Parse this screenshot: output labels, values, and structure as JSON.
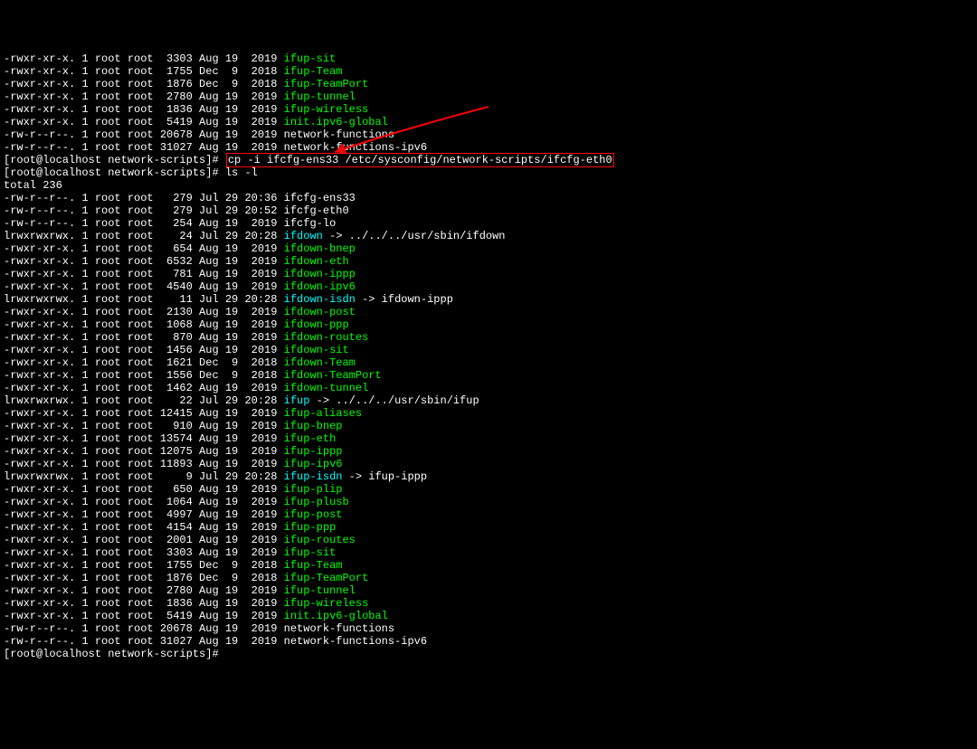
{
  "chart_data": null,
  "prompts": {
    "p1": "[root@localhost network-scripts]# ",
    "p2": "[root@localhost network-scripts]# ",
    "p3": "[root@localhost network-scripts]# "
  },
  "commands": {
    "cp": "cp -i ifcfg-ens33 /etc/sysconfig/network-scripts/ifcfg-eth0",
    "ls": "ls -l"
  },
  "headers": {
    "top_partial": [
      {
        "meta": "-rwxr-xr-x. 1 root root  3303 Aug 19  2019 ",
        "name": "ifup-sit",
        "cls": "g"
      },
      {
        "meta": "-rwxr-xr-x. 1 root root  1755 Dec  9  2018 ",
        "name": "ifup-Team",
        "cls": "g"
      },
      {
        "meta": "-rwxr-xr-x. 1 root root  1876 Dec  9  2018 ",
        "name": "ifup-TeamPort",
        "cls": "g"
      },
      {
        "meta": "-rwxr-xr-x. 1 root root  2780 Aug 19  2019 ",
        "name": "ifup-tunnel",
        "cls": "g"
      },
      {
        "meta": "-rwxr-xr-x. 1 root root  1836 Aug 19  2019 ",
        "name": "ifup-wireless",
        "cls": "g"
      },
      {
        "meta": "-rwxr-xr-x. 1 root root  5419 Aug 19  2019 ",
        "name": "init.ipv6-global",
        "cls": "g"
      },
      {
        "meta": "-rw-r--r--. 1 root root 20678 Aug 19  2019 ",
        "name": "network-functions",
        "cls": "w"
      },
      {
        "meta": "-rw-r--r--. 1 root root 31027 Aug 19  2019 ",
        "name": "network-functions-ipv6",
        "cls": "w"
      }
    ]
  },
  "total": "total 236",
  "listing": [
    {
      "meta": "-rw-r--r--. 1 root root   279 Jul 29 20:36 ",
      "name": "ifcfg-ens33",
      "cls": "w"
    },
    {
      "meta": "-rw-r--r--. 1 root root   279 Jul 29 20:52 ",
      "name": "ifcfg-eth0",
      "cls": "w"
    },
    {
      "meta": "-rw-r--r--. 1 root root   254 Aug 19  2019 ",
      "name": "ifcfg-lo",
      "cls": "w"
    },
    {
      "meta": "lrwxrwxrwx. 1 root root    24 Jul 29 20:28 ",
      "name": "ifdown",
      "cls": "c",
      "link": " -> ../../../usr/sbin/ifdown"
    },
    {
      "meta": "-rwxr-xr-x. 1 root root   654 Aug 19  2019 ",
      "name": "ifdown-bnep",
      "cls": "g"
    },
    {
      "meta": "-rwxr-xr-x. 1 root root  6532 Aug 19  2019 ",
      "name": "ifdown-eth",
      "cls": "g"
    },
    {
      "meta": "-rwxr-xr-x. 1 root root   781 Aug 19  2019 ",
      "name": "ifdown-ippp",
      "cls": "g"
    },
    {
      "meta": "-rwxr-xr-x. 1 root root  4540 Aug 19  2019 ",
      "name": "ifdown-ipv6",
      "cls": "g"
    },
    {
      "meta": "lrwxrwxrwx. 1 root root    11 Jul 29 20:28 ",
      "name": "ifdown-isdn",
      "cls": "c",
      "link": " -> ifdown-ippp"
    },
    {
      "meta": "-rwxr-xr-x. 1 root root  2130 Aug 19  2019 ",
      "name": "ifdown-post",
      "cls": "g"
    },
    {
      "meta": "-rwxr-xr-x. 1 root root  1068 Aug 19  2019 ",
      "name": "ifdown-ppp",
      "cls": "g"
    },
    {
      "meta": "-rwxr-xr-x. 1 root root   870 Aug 19  2019 ",
      "name": "ifdown-routes",
      "cls": "g"
    },
    {
      "meta": "-rwxr-xr-x. 1 root root  1456 Aug 19  2019 ",
      "name": "ifdown-sit",
      "cls": "g"
    },
    {
      "meta": "-rwxr-xr-x. 1 root root  1621 Dec  9  2018 ",
      "name": "ifdown-Team",
      "cls": "g"
    },
    {
      "meta": "-rwxr-xr-x. 1 root root  1556 Dec  9  2018 ",
      "name": "ifdown-TeamPort",
      "cls": "g"
    },
    {
      "meta": "-rwxr-xr-x. 1 root root  1462 Aug 19  2019 ",
      "name": "ifdown-tunnel",
      "cls": "g"
    },
    {
      "meta": "lrwxrwxrwx. 1 root root    22 Jul 29 20:28 ",
      "name": "ifup",
      "cls": "c",
      "link": " -> ../../../usr/sbin/ifup"
    },
    {
      "meta": "-rwxr-xr-x. 1 root root 12415 Aug 19  2019 ",
      "name": "ifup-aliases",
      "cls": "g"
    },
    {
      "meta": "-rwxr-xr-x. 1 root root   910 Aug 19  2019 ",
      "name": "ifup-bnep",
      "cls": "g"
    },
    {
      "meta": "-rwxr-xr-x. 1 root root 13574 Aug 19  2019 ",
      "name": "ifup-eth",
      "cls": "g"
    },
    {
      "meta": "-rwxr-xr-x. 1 root root 12075 Aug 19  2019 ",
      "name": "ifup-ippp",
      "cls": "g"
    },
    {
      "meta": "-rwxr-xr-x. 1 root root 11893 Aug 19  2019 ",
      "name": "ifup-ipv6",
      "cls": "g"
    },
    {
      "meta": "lrwxrwxrwx. 1 root root     9 Jul 29 20:28 ",
      "name": "ifup-isdn",
      "cls": "c",
      "link": " -> ifup-ippp"
    },
    {
      "meta": "-rwxr-xr-x. 1 root root   650 Aug 19  2019 ",
      "name": "ifup-plip",
      "cls": "g"
    },
    {
      "meta": "-rwxr-xr-x. 1 root root  1064 Aug 19  2019 ",
      "name": "ifup-plusb",
      "cls": "g"
    },
    {
      "meta": "-rwxr-xr-x. 1 root root  4997 Aug 19  2019 ",
      "name": "ifup-post",
      "cls": "g"
    },
    {
      "meta": "-rwxr-xr-x. 1 root root  4154 Aug 19  2019 ",
      "name": "ifup-ppp",
      "cls": "g"
    },
    {
      "meta": "-rwxr-xr-x. 1 root root  2001 Aug 19  2019 ",
      "name": "ifup-routes",
      "cls": "g"
    },
    {
      "meta": "-rwxr-xr-x. 1 root root  3303 Aug 19  2019 ",
      "name": "ifup-sit",
      "cls": "g"
    },
    {
      "meta": "-rwxr-xr-x. 1 root root  1755 Dec  9  2018 ",
      "name": "ifup-Team",
      "cls": "g"
    },
    {
      "meta": "-rwxr-xr-x. 1 root root  1876 Dec  9  2018 ",
      "name": "ifup-TeamPort",
      "cls": "g"
    },
    {
      "meta": "-rwxr-xr-x. 1 root root  2780 Aug 19  2019 ",
      "name": "ifup-tunnel",
      "cls": "g"
    },
    {
      "meta": "-rwxr-xr-x. 1 root root  1836 Aug 19  2019 ",
      "name": "ifup-wireless",
      "cls": "g"
    },
    {
      "meta": "-rwxr-xr-x. 1 root root  5419 Aug 19  2019 ",
      "name": "init.ipv6-global",
      "cls": "g"
    },
    {
      "meta": "-rw-r--r--. 1 root root 20678 Aug 19  2019 ",
      "name": "network-functions",
      "cls": "w"
    },
    {
      "meta": "-rw-r--r--. 1 root root 31027 Aug 19  2019 ",
      "name": "network-functions-ipv6",
      "cls": "w"
    }
  ]
}
